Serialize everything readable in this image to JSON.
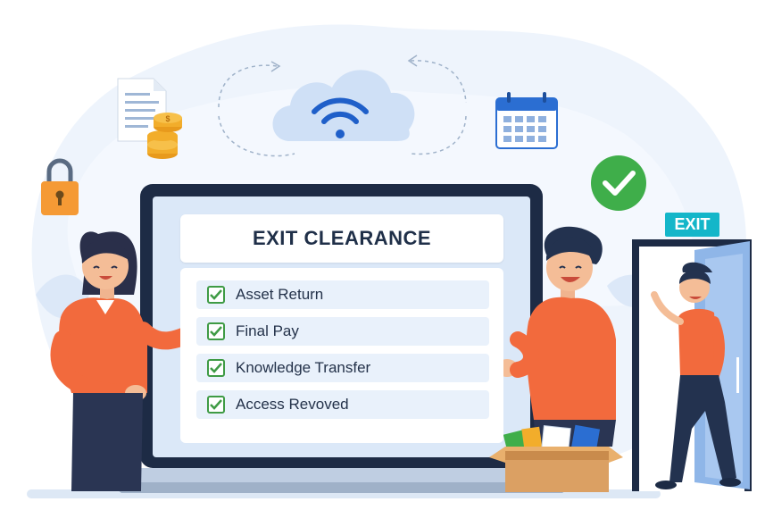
{
  "panel": {
    "title": "EXIT CLEARANCE",
    "items": [
      {
        "label": "Asset Return",
        "checked": true
      },
      {
        "label": "Final Pay",
        "checked": true
      },
      {
        "label": "Knowledge Transfer",
        "checked": true
      },
      {
        "label": "Access Revoved",
        "checked": true
      }
    ]
  },
  "exit_sign": "EXIT",
  "icons": [
    "document-icon",
    "coins-icon",
    "padlock-icon",
    "cloud-wifi-icon",
    "calendar-icon",
    "checkmark-badge-icon",
    "id-badge-icon",
    "laptop-icon",
    "box-icon",
    "door-icon"
  ],
  "colors": {
    "accent_blue": "#2f6fd6",
    "check_green": "#3f9b45",
    "shirt_orange": "#f26a3d",
    "exit_teal": "#14b6c9",
    "screen_frame": "#1d2b45"
  }
}
